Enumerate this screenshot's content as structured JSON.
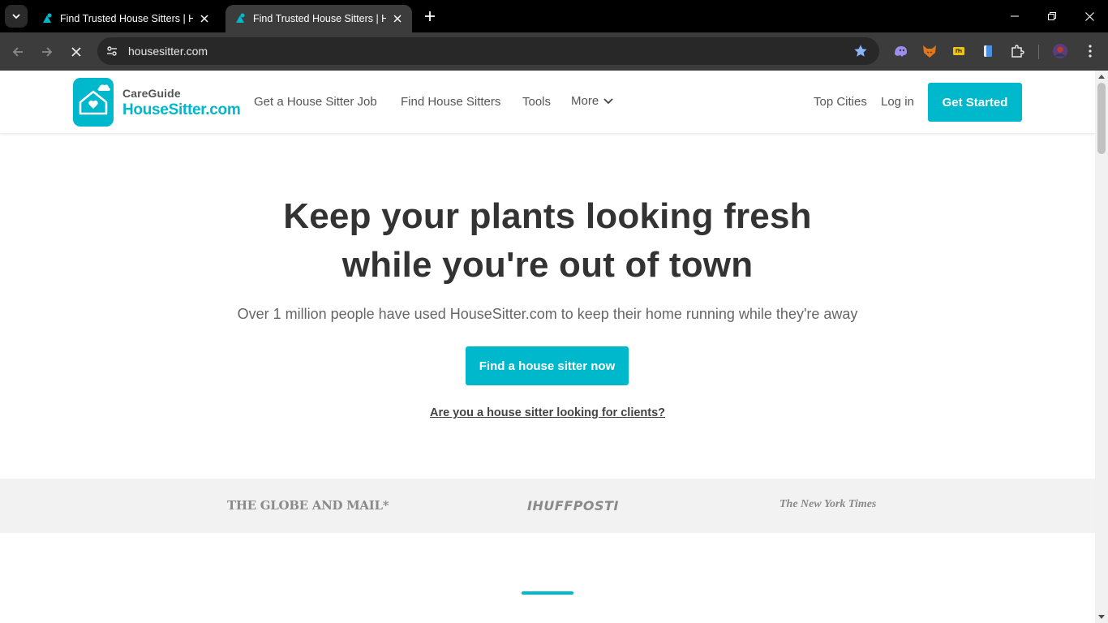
{
  "browser": {
    "tabs": [
      {
        "title": "Find Trusted House Sitters | HouseSitter.com",
        "active": false
      },
      {
        "title": "Find Trusted House Sitters | HouseSitter.com",
        "active": true
      }
    ],
    "url": "housesitter.com",
    "accent": "#00b8cc"
  },
  "header": {
    "logo_top": "CareGuide",
    "logo_bottom": "HouseSitter.com",
    "nav": {
      "get_job": "Get a House Sitter Job",
      "find_sitters": "Find House Sitters",
      "tools": "Tools",
      "more": "More",
      "top_cities": "Top Cities",
      "login": "Log in"
    },
    "get_started": "Get Started"
  },
  "hero": {
    "title_line1": "Keep your plants looking fresh",
    "title_line2": "while you're out of town",
    "subtitle": "Over 1 million people have used HouseSitter.com to keep their home running while they're away",
    "cta": "Find a house sitter now",
    "sitter_link": "Are you a house sitter looking for clients?"
  },
  "press": {
    "globe": "THE GLOBE AND MAIL*",
    "huff": "IHUFFPOSTI",
    "nyt": "The New York Times"
  }
}
